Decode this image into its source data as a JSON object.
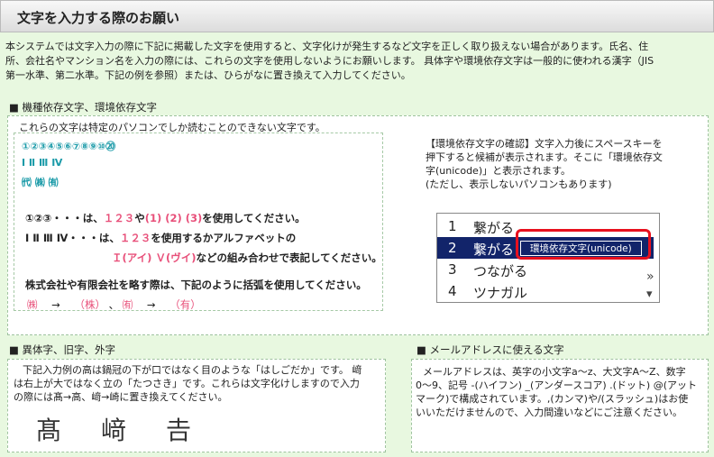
{
  "header": {
    "title": "文字を入力する際のお願い"
  },
  "intro": {
    "line1": "本システムでは文字入力の際に下記に掲載した文字を使用すると、文字化けが発生するなど文字を正しく取り扱えない場合があります。氏名、住",
    "line2": "所、会社名やマンション名を入力の際には、これらの文字を使用しないようにお願いします。 具体字や環境依存文字は一般的に使われる漢字（JIS",
    "line3": "第一水準、第二水準。下記の例を参照）または、ひらがなに置き換えて入力してください。"
  },
  "section1": {
    "heading": "■ 機種依存文字、環境依存文字",
    "note": "これらの文字は特定のパソコンでしか読むことのできない文字です。",
    "examples": [
      "①②③④⑤⑥⑦⑧⑨⑩⑳",
      "Ⅰ Ⅱ Ⅲ Ⅳ",
      "㈹ ㈱ ㈲"
    ],
    "rule1_pre": "①②③・・・は、",
    "rule1_nums": "１２３",
    "rule1_mid": "や",
    "rule1_alt": "(1) (2) (3)",
    "rule1_post": "を使用してください。",
    "rule2_pre": "Ⅰ Ⅱ Ⅲ Ⅳ・・・は、",
    "rule2_nums": "１２３",
    "rule2_post": "を使用するかアルファベットの",
    "rule3_alt": "Ｉ(アイ) Ｖ(ヴイ)",
    "rule3_post": "などの組み合わせで表記してください。",
    "rule4": "株式会社や有限会社を略す際は、下記のように括弧を使用してください。",
    "rule5_a": "㈱",
    "arrow": "→",
    "rule5_b": "（株）",
    "sep": "、",
    "rule5_c": "㈲",
    "rule5_d": "（有）"
  },
  "unicode_note": {
    "line1": "【環境依存文字の確認】文字入力後にスペースキーを",
    "line2": "押下すると候補が表示されます。そこに「環境依存文",
    "line3": "字(unicode)」と表示されます。",
    "line4": "(ただし、表示しないパソコンもあります)"
  },
  "ime": {
    "candidates": [
      {
        "num": "1",
        "word": "繋がる"
      },
      {
        "num": "2",
        "word": "繋がる"
      },
      {
        "num": "3",
        "word": "つながる"
      },
      {
        "num": "4",
        "word": "ツナガル"
      }
    ],
    "tag": "環境依存文字(unicode)",
    "more": "»",
    "down": "▾"
  },
  "section2": {
    "heading": "■ 異体字、旧字、外字",
    "line1": "下記入力例の高は鍋冠の下が口ではなく目のような「はしごだか」です。 﨑",
    "line2": "は右上が大ではなく立の「たつさき」です。これらは文字化けしますので入力",
    "line3": "の際には髙→高、﨑→崎に置き換えてください。",
    "kanji": [
      "髙",
      "﨑",
      "𠮷"
    ]
  },
  "section3": {
    "heading": "■ メールアドレスに使える文字",
    "line1": "メールアドレスは、英字の小文字a〜z、大文字A〜Z、数字",
    "line2": "0〜9、記号 -(ハイフン) _(アンダースコア) .(ドット) @(アット",
    "line3": "マーク)で構成されています。,(カンマ)や/(スラッシュ)はお使",
    "line4": "いいただけませんので、入力間違いなどにご注意ください。"
  }
}
